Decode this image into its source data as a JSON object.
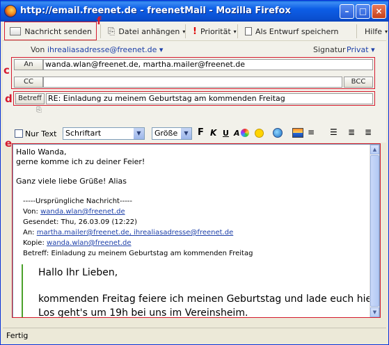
{
  "window": {
    "title": "http://email.freenet.de - freenetMail - Mozilla Firefox",
    "min_glyph": "–",
    "max_glyph": "□",
    "close_glyph": "×"
  },
  "toolbar": {
    "send_label": "Nachricht senden",
    "attach_label": "Datei anhängen",
    "priority_label": "Priorität",
    "draft_label": "Als Entwurf speichern",
    "help_label": "Hilfe",
    "dropdown_glyph": "▾",
    "priority_glyph": "!"
  },
  "markers": {
    "c": "c",
    "d": "d",
    "e": "e",
    "f": "f",
    "color": "#d51a2e"
  },
  "header": {
    "from_label": "Von",
    "from_value": "ihrealiasadresse@freenet.de ▾",
    "signature_label": "Signatur",
    "signature_value": "Privat ▾",
    "to_button": "An",
    "to_value": "wanda.wlan@freenet.de, martha.mailer@freenet.de",
    "cc_button": "CC",
    "cc_value": "",
    "bcc_button": "BCC",
    "subject_label": "Betreff",
    "subject_value": "RE: Einladung zu meinem Geburtstag am kommenden Freitag"
  },
  "format": {
    "plain_text_label": "Nur Text",
    "font_select": "Schriftart",
    "size_select": "Größe",
    "bold": "F",
    "italic": "K",
    "underline": "U",
    "color_icon": "A",
    "select_arrow": "▼"
  },
  "editor": {
    "line1": "Hallo Wanda,",
    "line2": "gerne komme ich zu deiner Feier!",
    "line3": "Ganz viele liebe Grüße! Alias",
    "orig_header": "-----Ursprüngliche Nachricht-----",
    "from_label": "Von:",
    "from_value": "wanda.wlan@freenet.de",
    "sent_label": "Gesendet:",
    "sent_value": "Thu, 26.03.09 (12:22)",
    "to_label": "An:",
    "to_value": "martha.mailer@freenet.de, ihrealiasadresse@freenet.de",
    "copy_label": "Kopie:",
    "copy_value": "wanda.wlan@freenet.de",
    "subject_label": "Betreff:",
    "subject_value": "Einladung zu meinem Geburtstag am kommenden Freitag",
    "quote1": "Hallo Ihr Lieben,",
    "quote2": "kommenden Freitag feiere ich meinen Geburtstag und lade euch hier",
    "quote3": "Los geht's um 19h bei uns im Vereinsheim.",
    "scroll_up": "▲",
    "scroll_down": "▼"
  },
  "status": {
    "text": "Fertig"
  }
}
